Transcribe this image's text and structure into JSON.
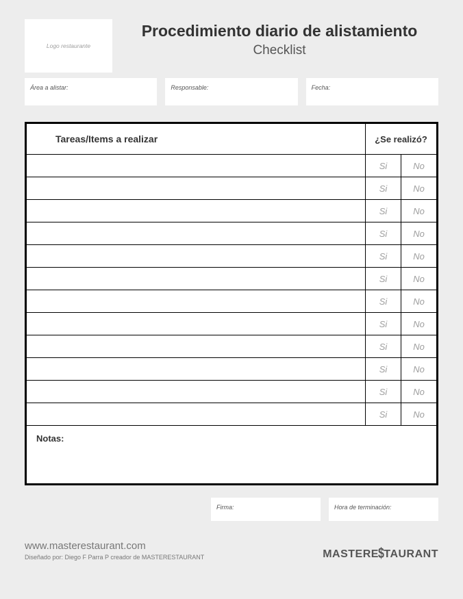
{
  "header": {
    "logo_placeholder": "Logo restaurante",
    "title": "Procedimiento diario de alistamiento",
    "subtitle": "Checklist"
  },
  "fields": {
    "area": "Área a alistar:",
    "responsible": "Responsable:",
    "date": "Fecha:"
  },
  "table": {
    "tasks_header": "Tareas/Items a realizar",
    "done_header": "¿Se realizó?",
    "yes_label": "Si",
    "no_label": "No",
    "row_count": 12,
    "notes_label": "Notas:"
  },
  "signature": {
    "sign_label": "Firma:",
    "end_time_label": "Hora de terminación:"
  },
  "footer": {
    "url": "www.masterestaurant.com",
    "credit": "Diseñado por: Diego F Parra P creador de MASTERESTAURANT",
    "brand_left": "MASTERE",
    "brand_right": "TAURANT"
  }
}
